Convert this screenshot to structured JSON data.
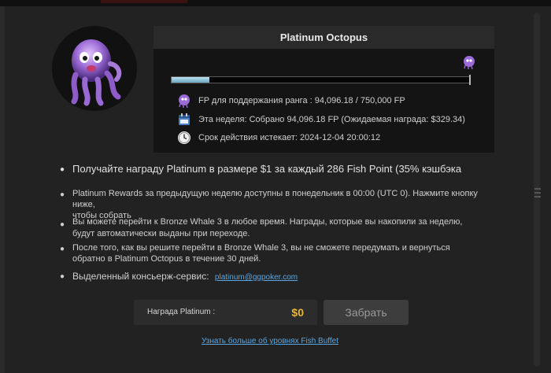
{
  "rank": {
    "title": "Platinum Octopus",
    "progress_fraction": 0.1254
  },
  "info": {
    "fp_maintain": "FP для поддержания ранга : 94,096.18 / 750,000 FP",
    "this_week": "Эта неделя: Собрано 94,096.18 FP (Ожидаемая награда: $329.34)",
    "expires": "Срок действия истекает: 2024-12-04 20:00:12"
  },
  "icons": {
    "avatar": "octopus-avatar",
    "rank": "octopus-rank-icon",
    "calendar": "calendar-icon",
    "clock": "clock-icon"
  },
  "bullets": {
    "b1": "Получайте награду Platinum в размере $1 за каждый 286 Fish Point (35% кэшбэка",
    "b2_line1": "Platinum Rewards за предыдущую неделю доступны в понедельник в 00:00 (UTC 0). Нажмите кнопку ниже,",
    "b2_line2": "чтобы собрать",
    "b3_line1": "Вы можете перейти к Bronze Whale 3 в любое время. Награды, которые вы накопили за неделю,",
    "b3_line2": "будут автоматически выданы при переходе.",
    "b4_line1": "После того, как вы решите перейти в Bronze Whale 3, вы не сможете передумать и вернуться",
    "b4_line2": "обратно в Platinum Octopus в течение 30 дней.",
    "b5_label": "Выделенный консьерж-сервис:",
    "b5_email": "platinum@ggpoker.com"
  },
  "reward": {
    "label": "Награда Platinum :",
    "value": "$0",
    "claim_label": "Забрать"
  },
  "learn_more": "Узнать больше об уровнях Fish Buffet",
  "colors": {
    "accent_gold": "#e7b73b",
    "link_blue": "#5aa6e0",
    "octopus_purple": "#8a5bc9"
  }
}
